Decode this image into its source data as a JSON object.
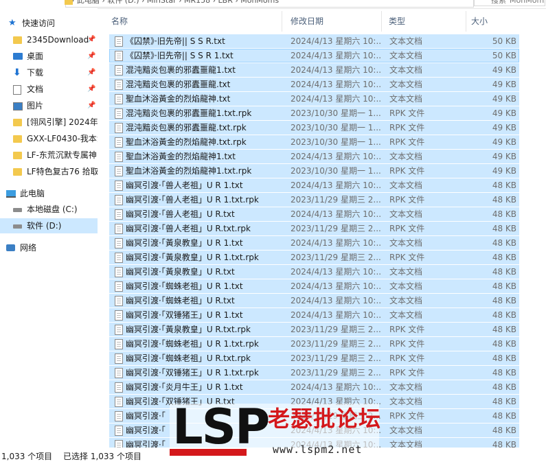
{
  "addressbar": {
    "path": "› 此电脑 › 软件 (D:) › MiriStar › MR158 › LBR › MonMoms",
    "search_placeholder": "搜索\"MonMoms\""
  },
  "nav": {
    "items": [
      {
        "label": "快速访问",
        "icon": "star-icon",
        "pinned": false
      },
      {
        "label": "2345Download",
        "icon": "folder-icon",
        "pinned": true
      },
      {
        "label": "桌面",
        "icon": "desktop-icon",
        "pinned": true
      },
      {
        "label": "下载",
        "icon": "download-icon",
        "pinned": true
      },
      {
        "label": "文档",
        "icon": "document-icon",
        "pinned": true
      },
      {
        "label": "图片",
        "icon": "pictures-icon",
        "pinned": true
      },
      {
        "label": "[翎风引擎] 2024年4",
        "icon": "folder-icon",
        "pinned": false
      },
      {
        "label": "GXX-LF0430-我本沉",
        "icon": "folder-icon",
        "pinned": false
      },
      {
        "label": "LF-东荒沉默专属神",
        "icon": "folder-icon",
        "pinned": false
      },
      {
        "label": "LF特色复古76 拾取",
        "icon": "folder-icon",
        "pinned": false
      },
      {
        "label": "此电脑",
        "icon": "computer-icon",
        "pinned": false
      },
      {
        "label": "本地磁盘 (C:)",
        "icon": "drive-icon",
        "pinned": false
      },
      {
        "label": "软件 (D:)",
        "icon": "drive-icon",
        "pinned": false,
        "selected": true
      },
      {
        "label": "网络",
        "icon": "network-icon",
        "pinned": false
      }
    ]
  },
  "columns": {
    "name": "名称",
    "date": "修改日期",
    "type": "类型",
    "size": "大小"
  },
  "files": [
    {
      "name": "《囚禁》·旧先帝|| S S R.txt",
      "date": "2024/4/13 星期六 10:...",
      "type": "文本文档",
      "size": "50 KB"
    },
    {
      "name": "《囚禁》·旧先帝|| S S R 1.txt",
      "date": "2024/4/13 星期六 10:...",
      "type": "文本文档",
      "size": "50 KB"
    },
    {
      "name": "混沌黯炎包裹的邪蠹噩龍1.txt",
      "date": "2024/4/13 星期六 10:...",
      "type": "文本文档",
      "size": "49 KB"
    },
    {
      "name": "混沌黯炎包裹的邪蠹噩龍.txt",
      "date": "2024/4/13 星期六 10:...",
      "type": "文本文档",
      "size": "49 KB"
    },
    {
      "name": "聖血沐浴黃金的烈焰龍神.txt",
      "date": "2024/4/13 星期六 10:...",
      "type": "文本文档",
      "size": "49 KB"
    },
    {
      "name": "混沌黯炎包裹的邪蠹噩龍1.txt.rpk",
      "date": "2023/10/30 星期一 1...",
      "type": "RPK 文件",
      "size": "49 KB"
    },
    {
      "name": "混沌黯炎包裹的邪蠹噩龍.txt.rpk",
      "date": "2023/10/30 星期一 1...",
      "type": "RPK 文件",
      "size": "49 KB"
    },
    {
      "name": "聖血沐浴黃金的烈焰龍神.txt.rpk",
      "date": "2023/10/30 星期一 1...",
      "type": "RPK 文件",
      "size": "49 KB"
    },
    {
      "name": "聖血沐浴黃金的烈焰龍神1.txt",
      "date": "2024/4/13 星期六 10:...",
      "type": "文本文档",
      "size": "49 KB"
    },
    {
      "name": "聖血沐浴黃金的烈焰龍神1.txt.rpk",
      "date": "2023/10/30 星期一 1...",
      "type": "RPK 文件",
      "size": "49 KB"
    },
    {
      "name": "幽冥引渡·「兽人老祖」U R 1.txt",
      "date": "2024/4/13 星期六 10:...",
      "type": "文本文档",
      "size": "48 KB"
    },
    {
      "name": "幽冥引渡·「兽人老祖」U R 1.txt.rpk",
      "date": "2023/11/29 星期三 2...",
      "type": "RPK 文件",
      "size": "48 KB"
    },
    {
      "name": "幽冥引渡·「兽人老祖」U R.txt",
      "date": "2024/4/13 星期六 10:...",
      "type": "文本文档",
      "size": "48 KB"
    },
    {
      "name": "幽冥引渡·「兽人老祖」U R.txt.rpk",
      "date": "2023/11/29 星期三 2...",
      "type": "RPK 文件",
      "size": "48 KB"
    },
    {
      "name": "幽冥引渡·「黃泉教皇」U R 1.txt",
      "date": "2024/4/13 星期六 10:...",
      "type": "文本文档",
      "size": "48 KB"
    },
    {
      "name": "幽冥引渡·「黃泉教皇」U R 1.txt.rpk",
      "date": "2023/11/29 星期三 2...",
      "type": "RPK 文件",
      "size": "48 KB"
    },
    {
      "name": "幽冥引渡·「黃泉教皇」U R.txt",
      "date": "2024/4/13 星期六 10:...",
      "type": "文本文档",
      "size": "48 KB"
    },
    {
      "name": "幽冥引渡·「蜘蛛老祖」U R 1.txt",
      "date": "2024/4/13 星期六 10:...",
      "type": "文本文档",
      "size": "48 KB"
    },
    {
      "name": "幽冥引渡·「蜘蛛老祖」U R.txt",
      "date": "2024/4/13 星期六 10:...",
      "type": "文本文档",
      "size": "48 KB"
    },
    {
      "name": "幽冥引渡·「双锤猪王」U R 1.txt",
      "date": "2024/4/13 星期六 10:...",
      "type": "文本文档",
      "size": "48 KB"
    },
    {
      "name": "幽冥引渡·「黃泉教皇」U R.txt.rpk",
      "date": "2023/11/29 星期三 2...",
      "type": "RPK 文件",
      "size": "48 KB"
    },
    {
      "name": "幽冥引渡·「蜘蛛老祖」U R 1.txt.rpk",
      "date": "2023/11/29 星期三 2...",
      "type": "RPK 文件",
      "size": "48 KB"
    },
    {
      "name": "幽冥引渡·「蜘蛛老祖」U R.txt.rpk",
      "date": "2023/11/29 星期三 2...",
      "type": "RPK 文件",
      "size": "48 KB"
    },
    {
      "name": "幽冥引渡·「双锤猪王」U R 1.txt.rpk",
      "date": "2023/11/29 星期三 2...",
      "type": "RPK 文件",
      "size": "48 KB"
    },
    {
      "name": "幽冥引渡·「炎月牛王」U R 1.txt",
      "date": "2024/4/13 星期六 10:...",
      "type": "文本文档",
      "size": "48 KB"
    },
    {
      "name": "幽冥引渡·「双锤猪王」U R.txt",
      "date": "2024/4/13 星期六 10:...",
      "type": "文本文档",
      "size": "48 KB"
    },
    {
      "name": "幽冥引渡·「",
      "date": "2023/11/29 星期三 2...",
      "type": "RPK 文件",
      "size": "48 KB"
    },
    {
      "name": "幽冥引渡·「",
      "date": "2024/4/13 星期六 10:...",
      "type": "文本文档",
      "size": "48 KB"
    },
    {
      "name": "幽冥引渡·「",
      "date": "2024/4/13 星期六 10:...",
      "type": "文本文档",
      "size": "48 KB"
    }
  ],
  "status": {
    "count": "1,033 个项目",
    "selected": "已选择 1,033 个项目"
  },
  "watermark": {
    "logo": "LSP",
    "title": "老瑟批论坛",
    "url": "www.lspm2.net"
  },
  "colors": {
    "selection": "#cce8ff",
    "header_text": "#4c607a",
    "watermark_red": "#d4181b"
  }
}
